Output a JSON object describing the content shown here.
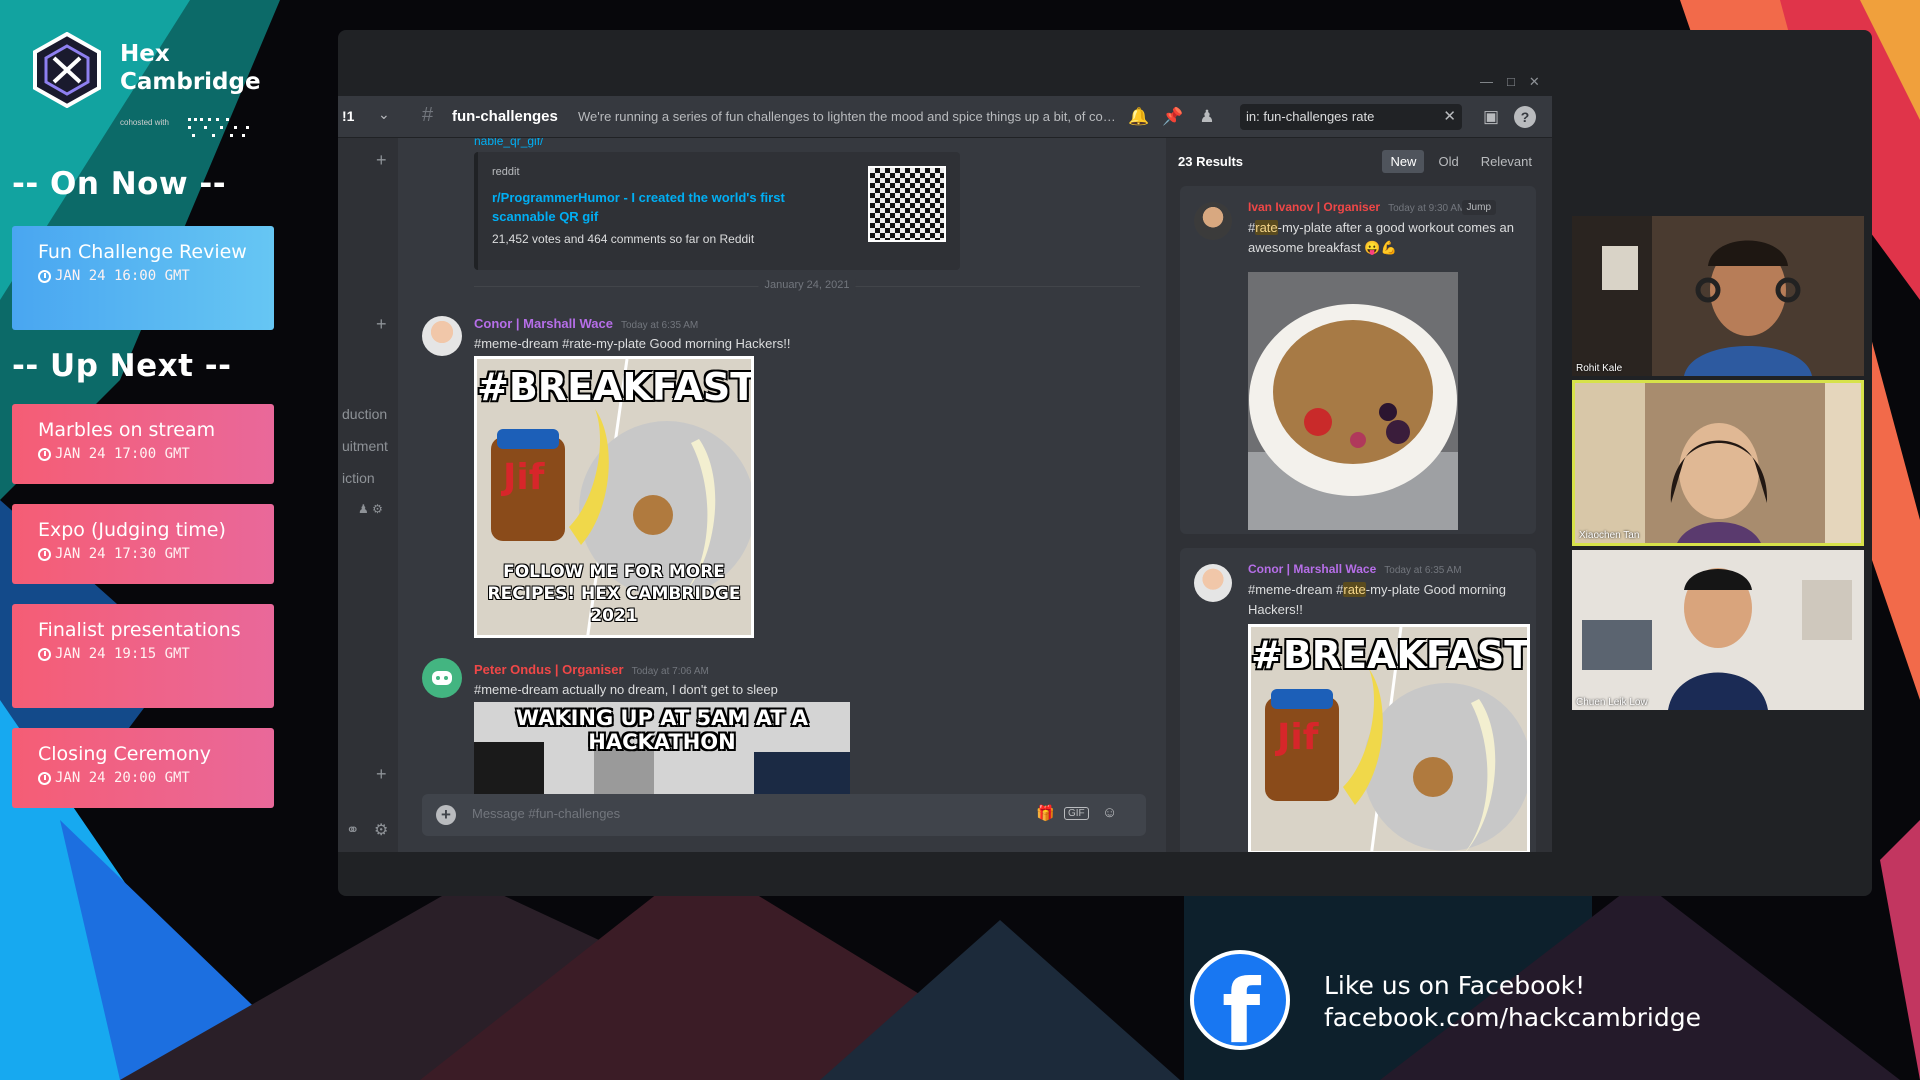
{
  "brand": {
    "name": "Hex\nCambridge",
    "cohosted_label": "cohosted with"
  },
  "schedule": {
    "on_now_heading": "-- On Now --",
    "up_next_heading": "-- Up Next --",
    "on_now": [
      {
        "title": "Fun Challenge Review",
        "time": "JAN 24 16:00 GMT"
      }
    ],
    "up_next": [
      {
        "title": "Marbles on stream",
        "time": "JAN 24 17:00 GMT"
      },
      {
        "title": "Expo (Judging time)",
        "time": "JAN 24 17:30 GMT"
      },
      {
        "title": "Finalist presentations",
        "time": "JAN 24 19:15 GMT"
      },
      {
        "title": "Closing Ceremony",
        "time": "JAN 24 20:00 GMT"
      }
    ]
  },
  "discord": {
    "server_label": "!1",
    "channel": "fun-challenges",
    "topic": "We're running a series of fun challenges to lighten the mood and spice things up a bit, of course ...",
    "search": {
      "filter": "in: fun-challenges",
      "query": "rate"
    },
    "sidebar_fragments": [
      "duction",
      "uitment",
      "iction"
    ],
    "embed": {
      "link": "nable_qr_gif/",
      "site": "reddit",
      "title": "r/ProgrammerHumor - I created the world's first scannable QR gif",
      "description": "21,452 votes and 464 comments so far on Reddit"
    },
    "date_divider": "January 24, 2021",
    "messages": [
      {
        "author": "Conor | Marshall Wace",
        "time": "Today at 6:35 AM",
        "text": "#meme-dream #rate-my-plate Good morning Hackers!!",
        "author_color": "#b66ee8"
      },
      {
        "author": "Peter Ondus | Organiser",
        "time": "Today at 7:06 AM",
        "text": "#meme-dream actually no dream, I don't get to sleep",
        "author_color": "#f04747"
      }
    ],
    "meme": {
      "top": "#BREAKFAST",
      "bottom": "FOLLOW ME FOR MORE\nRECIPES! HEX CAMBRIDGE 2021"
    },
    "wake_meme": "WAKING UP AT 5AM AT A HACKATHON",
    "composer_placeholder": "Message #fun-challenges",
    "composer_gif": "GIF",
    "results": {
      "count": "23 Results",
      "tabs": [
        "New",
        "Old",
        "Relevant"
      ],
      "active_tab": "New",
      "jump_label": "Jump",
      "items": [
        {
          "author": "Ivan Ivanov | Organiser",
          "time": "Today at 9:30 AM",
          "pre": "#",
          "hl": "rate",
          "post": "-my-plate after a good workout comes an awesome breakfast 😛💪"
        },
        {
          "author": "Conor | Marshall Wace",
          "time": "Today at 6:35 AM",
          "pre": "#meme-dream #",
          "hl": "rate",
          "post": "-my-plate Good morning Hackers!!"
        }
      ]
    }
  },
  "participants": [
    "Rohit Kale",
    "Xiaochen Tan",
    "Chuen Leik Low"
  ],
  "facebook": {
    "text": "Like us on Facebook!\nfacebook.com/hackcambridge",
    "logo_letter": "f"
  }
}
